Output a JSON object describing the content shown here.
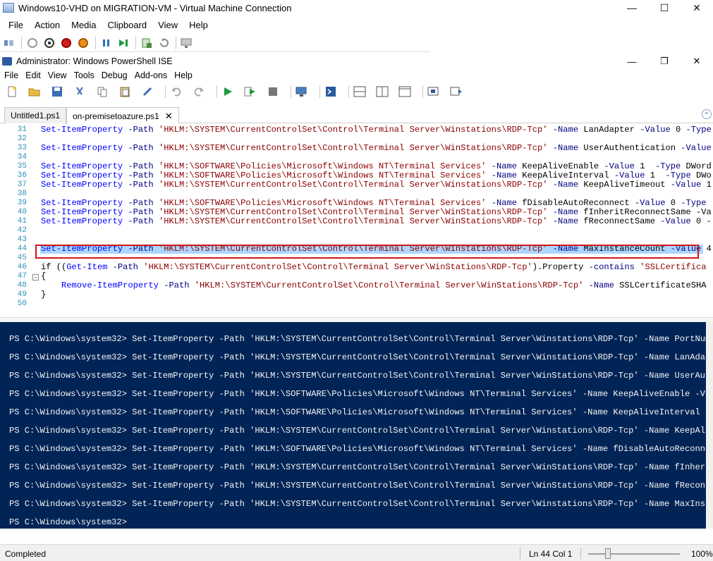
{
  "vm_window": {
    "title": "Windows10-VHD on MIGRATION-VM - Virtual Machine Connection",
    "menus": [
      "File",
      "Action",
      "Media",
      "Clipboard",
      "View",
      "Help"
    ],
    "controls": {
      "minimize": "—",
      "maximize": "☐",
      "close": "✕"
    }
  },
  "ise_window": {
    "title": "Administrator: Windows PowerShell ISE",
    "menus": [
      "File",
      "Edit",
      "View",
      "Tools",
      "Debug",
      "Add-ons",
      "Help"
    ],
    "controls": {
      "minimize": "—",
      "restore": "❐",
      "close": "✕"
    }
  },
  "tabs": [
    {
      "label": "Untitled1.ps1",
      "active": false
    },
    {
      "label": "on-premisetoazure.ps1",
      "active": true,
      "close": "✕"
    }
  ],
  "editor": {
    "line_numbers": [
      "31",
      "32",
      "33",
      "34",
      "35",
      "36",
      "37",
      "38",
      "39",
      "40",
      "41",
      "42",
      "43",
      "44",
      "45",
      "46",
      "47",
      "48",
      "49",
      "50"
    ],
    "lines": [
      "Set-ItemProperty -Path 'HKLM:\\SYSTEM\\CurrentControlSet\\Control\\Terminal Server\\Winstations\\RDP-Tcp' -Name LanAdapter -Value 0 -Type",
      "",
      "Set-ItemProperty -Path 'HKLM:\\SYSTEM\\CurrentControlSet\\Control\\Terminal Server\\WinStations\\RDP-Tcp' -Name UserAuthentication -Value",
      "",
      "Set-ItemProperty -Path 'HKLM:\\SOFTWARE\\Policies\\Microsoft\\Windows NT\\Terminal Services' -Name KeepAliveEnable -Value 1  -Type DWord",
      "Set-ItemProperty -Path 'HKLM:\\SOFTWARE\\Policies\\Microsoft\\Windows NT\\Terminal Services' -Name KeepAliveInterval -Value 1  -Type DWo",
      "Set-ItemProperty -Path 'HKLM:\\SYSTEM\\CurrentControlSet\\Control\\Terminal Server\\Winstations\\RDP-Tcp' -Name KeepAliveTimeout -Value 1",
      "",
      "Set-ItemProperty -Path 'HKLM:\\SOFTWARE\\Policies\\Microsoft\\Windows NT\\Terminal Services' -Name fDisableAutoReconnect -Value 0 -Type",
      "Set-ItemProperty -Path 'HKLM:\\SYSTEM\\CurrentControlSet\\Control\\Terminal Server\\WinStations\\RDP-Tcp' -Name fInheritReconnectSame -Va",
      "Set-ItemProperty -Path 'HKLM:\\SYSTEM\\CurrentControlSet\\Control\\Terminal Server\\WinStations\\RDP-Tcp' -Name fReconnectSame -Value 0 -",
      "",
      "",
      "Set-ItemProperty -Path 'HKLM:\\SYSTEM\\CurrentControlSet\\Control\\Terminal Server\\Winstations\\RDP-Tcp' -Name MaxInstanceCount -Value 4",
      "",
      "if ((Get-Item -Path 'HKLM:\\SYSTEM\\CurrentControlSet\\Control\\Terminal Server\\WinStations\\RDP-Tcp').Property -contains 'SSLCertifica",
      "{",
      "    Remove-ItemProperty -Path 'HKLM:\\SYSTEM\\CurrentControlSet\\Control\\Terminal Server\\WinStations\\RDP-Tcp' -Name SSLCertificateSHA",
      "}",
      ""
    ]
  },
  "console": {
    "lines": [
      "PS C:\\Windows\\system32> Set-ItemProperty -Path 'HKLM:\\SYSTEM\\CurrentControlSet\\Control\\Terminal Server\\Winstations\\RDP-Tcp' -Name PortNum",
      "PS C:\\Windows\\system32> Set-ItemProperty -Path 'HKLM:\\SYSTEM\\CurrentControlSet\\Control\\Terminal Server\\Winstations\\RDP-Tcp' -Name LanAdap",
      "PS C:\\Windows\\system32> Set-ItemProperty -Path 'HKLM:\\SYSTEM\\CurrentControlSet\\Control\\Terminal Server\\WinStations\\RDP-Tcp' -Name UserAut",
      "PS C:\\Windows\\system32> Set-ItemProperty -Path 'HKLM:\\SOFTWARE\\Policies\\Microsoft\\Windows NT\\Terminal Services' -Name KeepAliveEnable -Va",
      "PS C:\\Windows\\system32> Set-ItemProperty -Path 'HKLM:\\SOFTWARE\\Policies\\Microsoft\\Windows NT\\Terminal Services' -Name KeepAliveInterval -",
      "PS C:\\Windows\\system32> Set-ItemProperty -Path 'HKLM:\\SYSTEM\\CurrentControlSet\\Control\\Terminal Server\\Winstations\\RDP-Tcp' -Name KeepAli",
      "PS C:\\Windows\\system32> Set-ItemProperty -Path 'HKLM:\\SOFTWARE\\Policies\\Microsoft\\Windows NT\\Terminal Services' -Name fDisableAutoReconne",
      "PS C:\\Windows\\system32> Set-ItemProperty -Path 'HKLM:\\SYSTEM\\CurrentControlSet\\Control\\Terminal Server\\WinStations\\RDP-Tcp' -Name fInheri",
      "PS C:\\Windows\\system32> Set-ItemProperty -Path 'HKLM:\\SYSTEM\\CurrentControlSet\\Control\\Terminal Server\\WinStations\\RDP-Tcp' -Name fReconn",
      "PS C:\\Windows\\system32> Set-ItemProperty -Path 'HKLM:\\SYSTEM\\CurrentControlSet\\Control\\Terminal Server\\Winstations\\RDP-Tcp' -Name MaxInst",
      "PS C:\\Windows\\system32>"
    ]
  },
  "statusbar": {
    "status": "Completed",
    "position": "Ln 44  Col 1",
    "zoom": "100%",
    "zoom_level_percent": 100
  },
  "colors": {
    "console_bg": "#012456",
    "selection": "#add6ff",
    "highlight_box": "#d01818"
  }
}
